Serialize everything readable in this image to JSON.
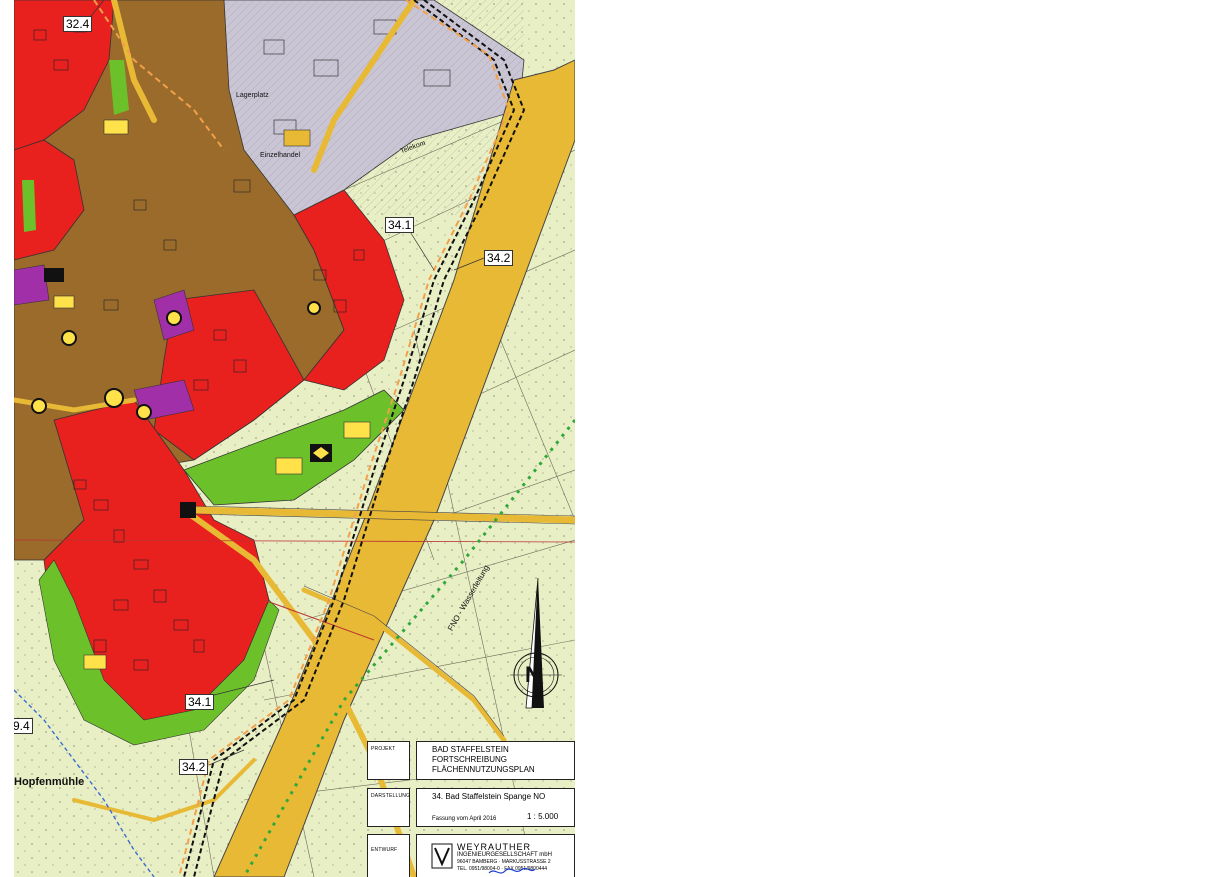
{
  "map": {
    "callouts": [
      "32.4",
      "34.1",
      "34.2",
      "34.1",
      "34.2",
      "9.4"
    ],
    "place_label": "Hopfenmühle",
    "street_labels": [
      "Lagerplatz",
      "Einzelhandel",
      "Telekom",
      "FNO - Wasserleitung"
    ],
    "north_symbol": "N",
    "colors": {
      "residential_red": "#e8201e",
      "mixed_brown": "#9a6b2b",
      "commercial_grey": "#c9c5d4",
      "green_space": "#6cc12b",
      "agriculture": "#e9efc4",
      "road_yellow": "#e8b935",
      "special_purple": "#a12fa8",
      "rail_dash": "#111111"
    }
  },
  "title_block": {
    "projekt_label": "PROJEKT",
    "darstellung_label": "DARSTELLUNG",
    "entwurf_label": "ENTWURF",
    "project_lines": [
      "BAD STAFFELSTEIN",
      "FORTSCHREIBUNG",
      "FLÄCHENNUTZUNGSPLAN"
    ],
    "plan_title": "34. Bad Staffelstein Spange NO",
    "version": "Fassung vom April 2016",
    "scale": "1 : 5.000",
    "firm_name": "WEYRAUTHER",
    "firm_sub": "INGENIEURGESELLSCHAFT mbH",
    "firm_address": "96047 BAMBERG · MARKUSSTRASSE 2",
    "firm_phone": "TEL. 0951/98004-0 · FAX 0951/9800444"
  }
}
